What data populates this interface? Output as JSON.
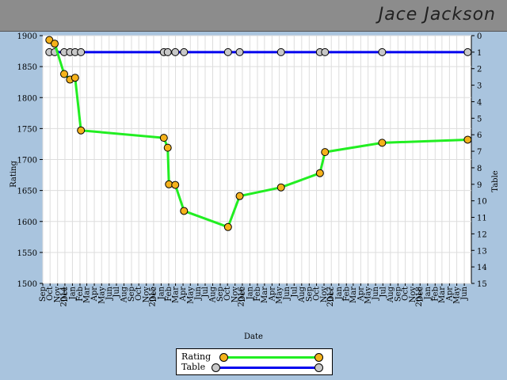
{
  "header": {
    "player_name": "Jace Jackson"
  },
  "chart_data": {
    "type": "line",
    "x_type": "date",
    "xlabel": "Date",
    "ylabel_left": "Rating",
    "ylabel_right": "Table",
    "left_axis": {
      "min": 1500,
      "max": 1900,
      "ticks": [
        1500,
        1550,
        1600,
        1650,
        1700,
        1750,
        1800,
        1850,
        1900
      ]
    },
    "right_axis": {
      "min": 0,
      "max": 15,
      "inverted": true,
      "ticks": [
        0,
        1,
        2,
        3,
        4,
        5,
        6,
        7,
        8,
        9,
        10,
        11,
        12,
        13,
        14,
        15
      ]
    },
    "x_range": [
      "2013-09-01",
      "2018-06-30"
    ],
    "year_labels": [
      {
        "date": "2014-01-01",
        "label": "2014"
      },
      {
        "date": "2015-01-01",
        "label": "2015"
      },
      {
        "date": "2016-01-01",
        "label": "2016"
      },
      {
        "date": "2017-01-01",
        "label": "2017"
      },
      {
        "date": "2018-01-01",
        "label": "2018"
      }
    ],
    "month_names": [
      "Jan",
      "Feb",
      "Mar",
      "Apr",
      "May",
      "Jun",
      "Jul",
      "Aug",
      "Sep",
      "Oct",
      "Nov",
      "Dec"
    ],
    "series": [
      {
        "name": "Rating",
        "axis": "left",
        "line_color": "#22ee22",
        "marker_color": "#f5b21b",
        "points": [
          {
            "x": "2013-09-28",
            "y": 1893
          },
          {
            "x": "2013-10-20",
            "y": 1887
          },
          {
            "x": "2013-11-28",
            "y": 1838
          },
          {
            "x": "2013-12-22",
            "y": 1829
          },
          {
            "x": "2014-01-12",
            "y": 1832
          },
          {
            "x": "2014-02-05",
            "y": 1747
          },
          {
            "x": "2015-01-12",
            "y": 1735
          },
          {
            "x": "2015-01-28",
            "y": 1719
          },
          {
            "x": "2015-02-02",
            "y": 1660
          },
          {
            "x": "2015-02-28",
            "y": 1659
          },
          {
            "x": "2015-04-05",
            "y": 1617
          },
          {
            "x": "2015-10-03",
            "y": 1591
          },
          {
            "x": "2015-11-20",
            "y": 1641
          },
          {
            "x": "2016-05-08",
            "y": 1655
          },
          {
            "x": "2016-10-15",
            "y": 1678
          },
          {
            "x": "2016-11-05",
            "y": 1712
          },
          {
            "x": "2017-06-28",
            "y": 1727
          },
          {
            "x": "2018-06-15",
            "y": 1732
          }
        ]
      },
      {
        "name": "Table",
        "axis": "right",
        "line_color": "#0000ee",
        "marker_color": "#c8c8c8",
        "points": [
          {
            "x": "2013-09-28",
            "y": 1
          },
          {
            "x": "2013-10-20",
            "y": 1
          },
          {
            "x": "2013-11-28",
            "y": 1
          },
          {
            "x": "2013-12-22",
            "y": 1
          },
          {
            "x": "2014-01-12",
            "y": 1
          },
          {
            "x": "2014-02-05",
            "y": 1
          },
          {
            "x": "2015-01-12",
            "y": 1
          },
          {
            "x": "2015-01-28",
            "y": 1
          },
          {
            "x": "2015-02-28",
            "y": 1
          },
          {
            "x": "2015-04-05",
            "y": 1
          },
          {
            "x": "2015-10-03",
            "y": 1
          },
          {
            "x": "2015-11-20",
            "y": 1
          },
          {
            "x": "2016-05-08",
            "y": 1
          },
          {
            "x": "2016-10-15",
            "y": 1
          },
          {
            "x": "2016-11-05",
            "y": 1
          },
          {
            "x": "2017-06-28",
            "y": 1
          },
          {
            "x": "2018-06-15",
            "y": 1
          }
        ]
      }
    ],
    "grid": true,
    "legend_position": "bottom-center"
  }
}
